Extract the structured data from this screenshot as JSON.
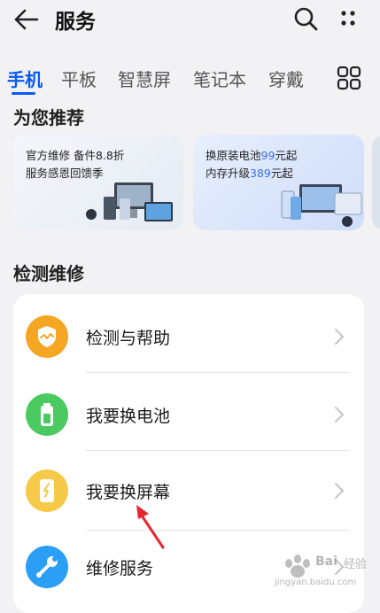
{
  "header": {
    "title": "服务"
  },
  "tabs": [
    {
      "label": "手机"
    },
    {
      "label": "平板"
    },
    {
      "label": "智慧屏"
    },
    {
      "label": "笔记本"
    },
    {
      "label": "穿戴"
    }
  ],
  "recommend": {
    "title": "为您推荐",
    "cards": [
      {
        "line1": "官方维修 备件8.8折",
        "line2": "服务感恩回馈季"
      },
      {
        "line1_pre": "换原装电池",
        "line1_hl": "99",
        "line1_post": "元起",
        "line2_pre": "内存升级",
        "line2_hl": "389",
        "line2_post": "元起"
      }
    ]
  },
  "repair": {
    "title": "检测维修",
    "items": [
      {
        "label": "检测与帮助",
        "icon": "shield-check-icon",
        "color": "#f5a623"
      },
      {
        "label": "我要换电池",
        "icon": "battery-icon",
        "color": "#4cca62"
      },
      {
        "label": "我要换屏幕",
        "icon": "phone-screen-icon",
        "color": "#f7c948"
      },
      {
        "label": "维修服务",
        "icon": "wrench-icon",
        "color": "#2a9ff5"
      }
    ]
  },
  "watermark": {
    "brand": "Bai",
    "sub": "经验",
    "url": "jingyan.baidu.com"
  },
  "colors": {
    "accent": "#0a59f7",
    "annotation": "#e8252f"
  }
}
